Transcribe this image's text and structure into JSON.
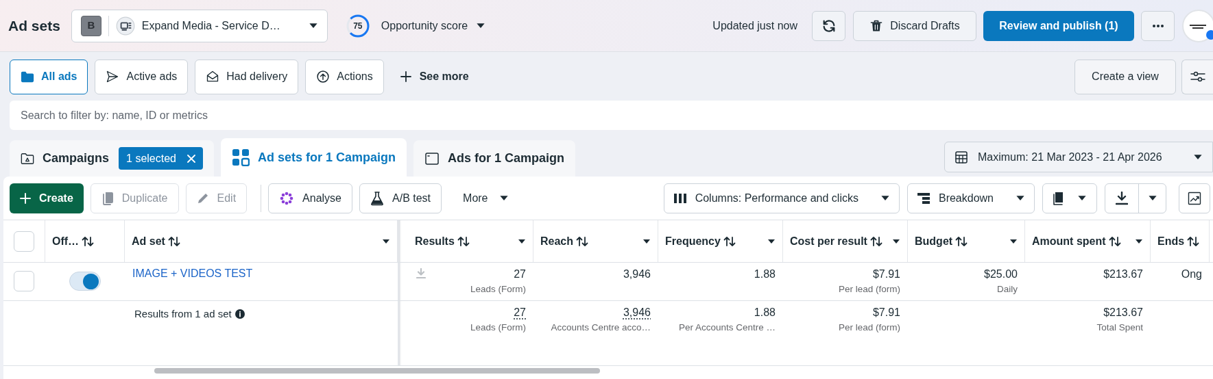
{
  "header": {
    "title": "Ad sets",
    "account": {
      "initial": "B",
      "name": "Expand Media - Service D…"
    },
    "opportunity": {
      "score": "75",
      "label": "Opportunity score"
    },
    "updated": "Updated just now",
    "discard": "Discard Drafts",
    "publish": "Review and publish (1)"
  },
  "filters": [
    {
      "label": "All ads",
      "selected": true
    },
    {
      "label": "Active ads",
      "selected": false
    },
    {
      "label": "Had delivery",
      "selected": false
    },
    {
      "label": "Actions",
      "selected": false
    }
  ],
  "see_more": "See more",
  "create_view": "Create a view",
  "search": {
    "placeholder": "Search to filter by: name, ID or metrics"
  },
  "level_tabs": [
    {
      "label": "Campaigns",
      "selected": false,
      "badge": "1 selected"
    },
    {
      "label": "Ad sets for 1 Campaign",
      "selected": true
    },
    {
      "label": "Ads for 1 Campaign",
      "selected": false
    }
  ],
  "date_range": "Maximum: 21 Mar 2023 - 21 Apr 2026",
  "toolbar": {
    "left": [
      {
        "kind": "primary",
        "label": "Create",
        "disabled": false
      },
      {
        "kind": "button",
        "label": "Duplicate",
        "disabled": true
      },
      {
        "kind": "button",
        "label": "Edit",
        "disabled": true
      },
      {
        "kind": "divider"
      },
      {
        "kind": "button",
        "label": "Analyse",
        "disabled": false
      },
      {
        "kind": "button",
        "label": "A/B test",
        "disabled": false
      },
      {
        "kind": "menu",
        "label": "More",
        "disabled": false
      }
    ],
    "right": [
      {
        "kind": "menu",
        "label": "Columns: Performance and clicks"
      },
      {
        "kind": "menu",
        "label": "Breakdown"
      },
      {
        "kind": "icon_menu"
      },
      {
        "kind": "split"
      },
      {
        "kind": "icon"
      }
    ]
  },
  "table": {
    "all_checked": false,
    "columns": [
      {
        "label": "Off…",
        "sortable": true,
        "menu": false
      },
      {
        "label": "Ad set",
        "sortable": true,
        "menu": true
      },
      {
        "label": "Results",
        "sortable": true,
        "menu": true
      },
      {
        "label": "Reach",
        "sortable": true,
        "menu": true
      },
      {
        "label": "Frequency",
        "sortable": true,
        "menu": true
      },
      {
        "label": "Cost per result",
        "sortable": true,
        "menu": true
      },
      {
        "label": "Budget",
        "sortable": true,
        "menu": true
      },
      {
        "label": "Amount spent",
        "sortable": true,
        "menu": true
      },
      {
        "label": "Ends",
        "sortable": true,
        "menu": false
      }
    ],
    "rows": [
      {
        "checked": false,
        "on": true,
        "name": "IMAGE + VIDEOS TEST",
        "cells": [
          {
            "value": "27",
            "sub": "Leads (Form)",
            "download": true
          },
          {
            "value": "3,946"
          },
          {
            "value": "1.88"
          },
          {
            "value": "$7.91",
            "sub": "Per lead (form)"
          },
          {
            "value": "$25.00",
            "sub": "Daily"
          },
          {
            "value": "$213.67"
          },
          {
            "value": "Ong"
          }
        ]
      }
    ],
    "summary": {
      "label": "Results from 1 ad set",
      "cells": [
        {
          "value": "27",
          "sub": "Leads (Form)",
          "dotted": true
        },
        {
          "value": "3,946",
          "sub": "Accounts Centre acco…",
          "dotted": true
        },
        {
          "value": "1.88",
          "sub": "Per Accounts Centre …"
        },
        {
          "value": "$7.91",
          "sub": "Per lead (form)"
        },
        null,
        {
          "value": "$213.67",
          "sub": "Total Spent"
        },
        null
      ]
    }
  }
}
